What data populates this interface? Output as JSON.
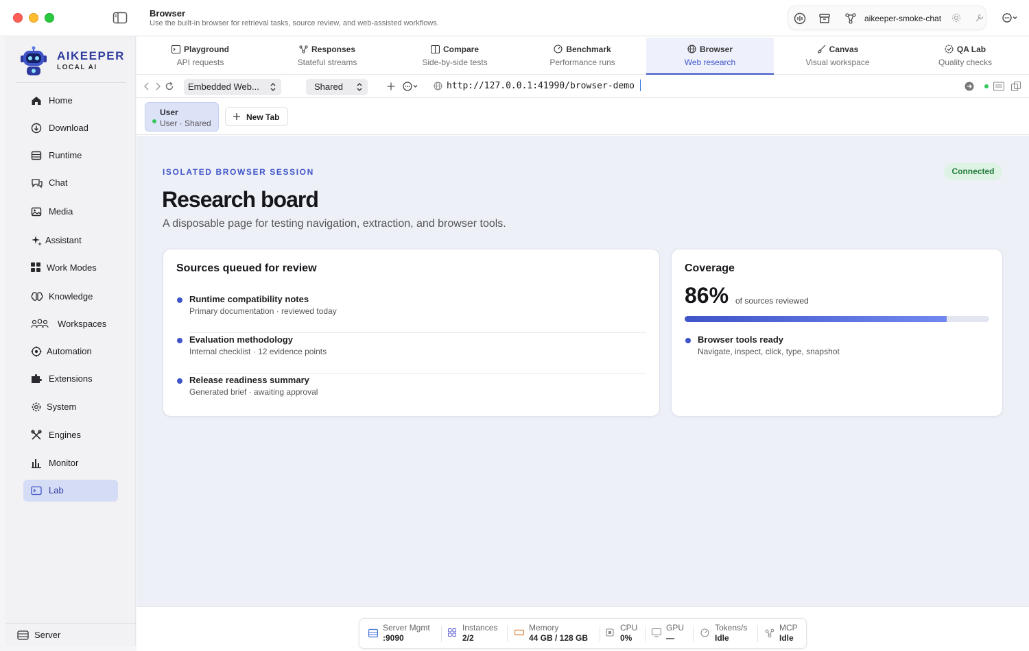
{
  "window": {
    "title": "Browser",
    "subtitle": "Use the built-in browser for retrieval tasks, source review, and web-assisted workflows."
  },
  "top_cluster": {
    "label": "aikeeper-smoke-chat",
    "icons": [
      "waveform-icon",
      "archive-icon",
      "branch-icon",
      "gear-icon",
      "wrench-icon"
    ]
  },
  "brand": {
    "name": "AIKEEPER",
    "tagline": "LOCAL AI"
  },
  "sidebar": {
    "items": [
      {
        "label": "Home",
        "icon": "home-icon"
      },
      {
        "label": "Download",
        "icon": "download-icon"
      },
      {
        "label": "Runtime",
        "icon": "runtime-icon"
      },
      {
        "label": "Chat",
        "icon": "chat-icon"
      },
      {
        "label": "Media",
        "icon": "media-icon"
      },
      {
        "label": "Assistant",
        "icon": "sparkle-icon"
      },
      {
        "label": "Work Modes",
        "icon": "grid-icon"
      },
      {
        "label": "Knowledge",
        "icon": "brain-icon"
      },
      {
        "label": "Workspaces",
        "icon": "people-icon"
      },
      {
        "label": "Automation",
        "icon": "automation-icon"
      },
      {
        "label": "Extensions",
        "icon": "puzzle-icon"
      },
      {
        "label": "System",
        "icon": "gear-icon"
      },
      {
        "label": "Engines",
        "icon": "tools-icon"
      },
      {
        "label": "Monitor",
        "icon": "chart-icon"
      },
      {
        "label": "Lab",
        "icon": "terminal-icon"
      }
    ],
    "active": "Lab",
    "footer": {
      "label": "Server",
      "icon": "server-icon"
    }
  },
  "tabs": [
    {
      "title": "Playground",
      "subtitle": "API requests",
      "icon": "terminal-icon"
    },
    {
      "title": "Responses",
      "subtitle": "Stateful streams",
      "icon": "branch-icon"
    },
    {
      "title": "Compare",
      "subtitle": "Side-by-side tests",
      "icon": "columns-icon"
    },
    {
      "title": "Benchmark",
      "subtitle": "Performance runs",
      "icon": "gauge-icon"
    },
    {
      "title": "Browser",
      "subtitle": "Web research",
      "icon": "globe-icon"
    },
    {
      "title": "Canvas",
      "subtitle": "Visual workspace",
      "icon": "brush-icon"
    },
    {
      "title": "QA Lab",
      "subtitle": "Quality checks",
      "icon": "badge-check-icon"
    }
  ],
  "active_tab": "Browser",
  "toolbar": {
    "engine_select": "Embedded Web...",
    "profile_select": "Shared",
    "url": "http://127.0.0.1:41990/browser-demo"
  },
  "session": {
    "name": "User",
    "sub": "User · Shared",
    "new_tab_label": "New Tab"
  },
  "page": {
    "eyebrow": "ISOLATED BROWSER SESSION",
    "status_badge": "Connected",
    "title": "Research board",
    "subtitle": "A disposable page for testing navigation, extraction, and browser tools.",
    "sources": {
      "title": "Sources queued for review",
      "items": [
        {
          "title": "Runtime compatibility notes",
          "sub": "Primary documentation · reviewed today"
        },
        {
          "title": "Evaluation methodology",
          "sub": "Internal checklist · 12 evidence points"
        },
        {
          "title": "Release readiness summary",
          "sub": "Generated brief · awaiting approval"
        }
      ]
    },
    "coverage": {
      "title": "Coverage",
      "value": "86%",
      "fraction": 0.86,
      "caption": "of sources reviewed",
      "item_title": "Browser tools ready",
      "item_sub": "Navigate, inspect, click, type, snapshot"
    }
  },
  "status_bar": [
    {
      "label": "Server Mgmt",
      "value": ":9090",
      "icon": "server-icon",
      "color": "#3e6fd8"
    },
    {
      "label": "Instances",
      "value": "2/2",
      "icon": "grid-icon",
      "color": "#5a5ad0"
    },
    {
      "label": "Memory",
      "value": "44 GB / 128 GB",
      "icon": "memory-icon",
      "color": "#e07b2a"
    },
    {
      "label": "CPU",
      "value": "0%",
      "icon": "cpu-icon",
      "color": "#888888"
    },
    {
      "label": "GPU",
      "value": "—",
      "icon": "monitor-icon",
      "color": "#888888"
    },
    {
      "label": "Tokens/s",
      "value": "Idle",
      "icon": "gauge-icon",
      "color": "#888888"
    },
    {
      "label": "MCP",
      "value": "Idle",
      "icon": "mcp-icon",
      "color": "#888888"
    }
  ]
}
